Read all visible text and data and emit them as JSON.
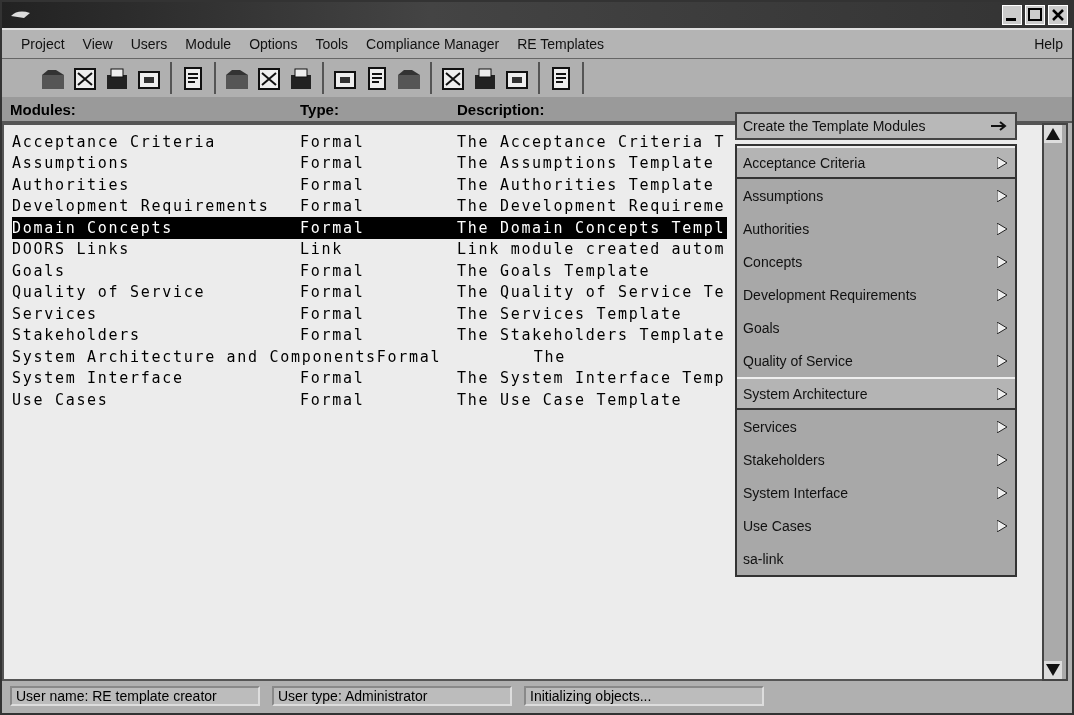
{
  "menubar": [
    {
      "label": "Project"
    },
    {
      "label": "View"
    },
    {
      "label": "Users"
    },
    {
      "label": "Module"
    },
    {
      "label": "Options"
    },
    {
      "label": "Tools"
    },
    {
      "label": "Compliance Manager"
    },
    {
      "label": "RE Templates"
    },
    {
      "label": "Help"
    }
  ],
  "table": {
    "columns": [
      "Modules:",
      "Type:",
      "Description:"
    ],
    "rows": [
      {
        "cells": [
          "Acceptance Criteria",
          "Formal",
          "The Acceptance Criteria T"
        ],
        "selected": false
      },
      {
        "cells": [
          "Assumptions",
          "Formal",
          "The Assumptions Template"
        ],
        "selected": false
      },
      {
        "cells": [
          "Authorities",
          "Formal",
          "The Authorities Template"
        ],
        "selected": false
      },
      {
        "cells": [
          "Development Requirements",
          "Formal",
          "The Development Requireme"
        ],
        "selected": false
      },
      {
        "cells": [
          "Domain Concepts",
          "Formal",
          "The Domain Concepts Templ"
        ],
        "selected": true
      },
      {
        "cells": [
          "DOORS Links",
          "Link",
          "Link module created autom"
        ],
        "selected": false
      },
      {
        "cells": [
          "Goals",
          "Formal",
          "The Goals Template"
        ],
        "selected": false
      },
      {
        "cells": [
          "Quality of Service",
          "Formal",
          "The Quality of Service Te"
        ],
        "selected": false
      },
      {
        "cells": [
          "Services",
          "Formal",
          "The Services Template"
        ],
        "selected": false
      },
      {
        "cells": [
          "Stakeholders",
          "Formal",
          "The Stakeholders Template"
        ],
        "selected": false
      },
      {
        "cells": [
          "System Architecture and Components",
          "Formal",
          "The"
        ],
        "selected": false
      },
      {
        "cells": [
          "System Interface",
          "Formal",
          "The System Interface Temp"
        ],
        "selected": false
      },
      {
        "cells": [
          "Use Cases",
          "Formal",
          "The Use Case Template"
        ],
        "selected": false
      }
    ]
  },
  "menu": {
    "header": "Create the Template Modules",
    "items": [
      {
        "label": "Acceptance Criteria",
        "raised": true,
        "submenu": true
      },
      {
        "label": "Assumptions",
        "raised": false,
        "submenu": true
      },
      {
        "label": "Authorities",
        "raised": false,
        "submenu": true
      },
      {
        "label": "Concepts",
        "raised": false,
        "submenu": true
      },
      {
        "label": "Development Requirements",
        "raised": false,
        "submenu": true
      },
      {
        "label": "Goals",
        "raised": false,
        "submenu": true
      },
      {
        "label": "Quality of Service",
        "raised": false,
        "submenu": true
      },
      {
        "label": "System Architecture",
        "raised": true,
        "submenu": true
      },
      {
        "label": "Services",
        "raised": false,
        "submenu": true
      },
      {
        "label": "Stakeholders",
        "raised": false,
        "submenu": true
      },
      {
        "label": "System Interface",
        "raised": false,
        "submenu": true
      },
      {
        "label": "Use Cases",
        "raised": false,
        "submenu": true
      },
      {
        "label": "sa-link",
        "raised": false,
        "submenu": false
      }
    ]
  },
  "status_bar": [
    "User name: RE template creator",
    "User type: Administrator",
    "Initializing objects..."
  ]
}
